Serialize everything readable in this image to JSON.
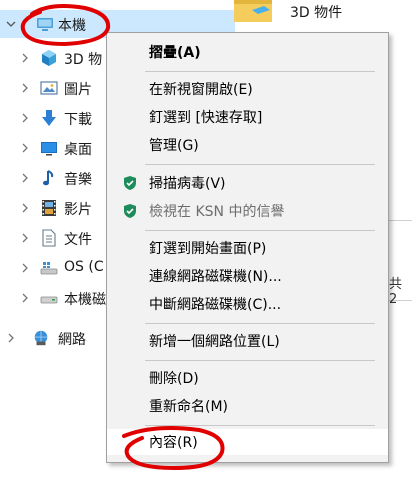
{
  "nav": {
    "items": [
      {
        "label": "本機",
        "icon": "pc-icon",
        "expanded": true,
        "selected": true
      },
      {
        "label": "3D 物",
        "icon": "3d-objects-icon"
      },
      {
        "label": "圖片",
        "icon": "pictures-icon"
      },
      {
        "label": "下載",
        "icon": "downloads-icon"
      },
      {
        "label": "桌面",
        "icon": "desktop-icon"
      },
      {
        "label": "音樂",
        "icon": "music-icon"
      },
      {
        "label": "影片",
        "icon": "videos-icon"
      },
      {
        "label": "文件",
        "icon": "documents-icon"
      },
      {
        "label": "OS (C",
        "icon": "os-drive-icon"
      },
      {
        "label": "本機磁",
        "icon": "local-disk-icon"
      },
      {
        "label": "網路",
        "icon": "network-icon"
      }
    ]
  },
  "content": {
    "folder_label": "3D 物件",
    "status_text": "共 2"
  },
  "context_menu": {
    "items": [
      {
        "label": "摺疊(A)",
        "bold": true
      },
      {
        "label": "在新視窗開啟(E)"
      },
      {
        "label": "釘選到 [快速存取]"
      },
      {
        "label": "管理(G)"
      },
      {
        "label": "掃描病毒(V)",
        "icon": "shield-icon"
      },
      {
        "label": "檢視在 KSN 中的信譽",
        "icon": "shield-icon",
        "disabled": true
      },
      {
        "label": "釘選到開始畫面(P)"
      },
      {
        "label": "連線網路磁碟機(N)..."
      },
      {
        "label": "中斷網路磁碟機(C)..."
      },
      {
        "label": "新增一個網路位置(L)"
      },
      {
        "label": "刪除(D)"
      },
      {
        "label": "重新命名(M)"
      },
      {
        "label": "內容(R)",
        "highlighted": true
      }
    ]
  },
  "colors": {
    "selection": "#cce8ff",
    "menu_bg": "#f2f2f2",
    "annotation": "#e00000",
    "shield": "#1e8c5a"
  }
}
